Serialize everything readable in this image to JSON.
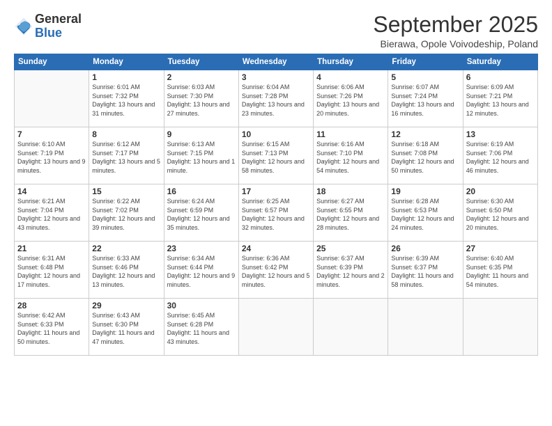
{
  "logo": {
    "general": "General",
    "blue": "Blue"
  },
  "title": "September 2025",
  "subtitle": "Bierawa, Opole Voivodeship, Poland",
  "headers": [
    "Sunday",
    "Monday",
    "Tuesday",
    "Wednesday",
    "Thursday",
    "Friday",
    "Saturday"
  ],
  "weeks": [
    [
      {
        "day": "",
        "sunrise": "",
        "sunset": "",
        "daylight": ""
      },
      {
        "day": "1",
        "sunrise": "Sunrise: 6:01 AM",
        "sunset": "Sunset: 7:32 PM",
        "daylight": "Daylight: 13 hours and 31 minutes."
      },
      {
        "day": "2",
        "sunrise": "Sunrise: 6:03 AM",
        "sunset": "Sunset: 7:30 PM",
        "daylight": "Daylight: 13 hours and 27 minutes."
      },
      {
        "day": "3",
        "sunrise": "Sunrise: 6:04 AM",
        "sunset": "Sunset: 7:28 PM",
        "daylight": "Daylight: 13 hours and 23 minutes."
      },
      {
        "day": "4",
        "sunrise": "Sunrise: 6:06 AM",
        "sunset": "Sunset: 7:26 PM",
        "daylight": "Daylight: 13 hours and 20 minutes."
      },
      {
        "day": "5",
        "sunrise": "Sunrise: 6:07 AM",
        "sunset": "Sunset: 7:24 PM",
        "daylight": "Daylight: 13 hours and 16 minutes."
      },
      {
        "day": "6",
        "sunrise": "Sunrise: 6:09 AM",
        "sunset": "Sunset: 7:21 PM",
        "daylight": "Daylight: 13 hours and 12 minutes."
      }
    ],
    [
      {
        "day": "7",
        "sunrise": "Sunrise: 6:10 AM",
        "sunset": "Sunset: 7:19 PM",
        "daylight": "Daylight: 13 hours and 9 minutes."
      },
      {
        "day": "8",
        "sunrise": "Sunrise: 6:12 AM",
        "sunset": "Sunset: 7:17 PM",
        "daylight": "Daylight: 13 hours and 5 minutes."
      },
      {
        "day": "9",
        "sunrise": "Sunrise: 6:13 AM",
        "sunset": "Sunset: 7:15 PM",
        "daylight": "Daylight: 13 hours and 1 minute."
      },
      {
        "day": "10",
        "sunrise": "Sunrise: 6:15 AM",
        "sunset": "Sunset: 7:13 PM",
        "daylight": "Daylight: 12 hours and 58 minutes."
      },
      {
        "day": "11",
        "sunrise": "Sunrise: 6:16 AM",
        "sunset": "Sunset: 7:10 PM",
        "daylight": "Daylight: 12 hours and 54 minutes."
      },
      {
        "day": "12",
        "sunrise": "Sunrise: 6:18 AM",
        "sunset": "Sunset: 7:08 PM",
        "daylight": "Daylight: 12 hours and 50 minutes."
      },
      {
        "day": "13",
        "sunrise": "Sunrise: 6:19 AM",
        "sunset": "Sunset: 7:06 PM",
        "daylight": "Daylight: 12 hours and 46 minutes."
      }
    ],
    [
      {
        "day": "14",
        "sunrise": "Sunrise: 6:21 AM",
        "sunset": "Sunset: 7:04 PM",
        "daylight": "Daylight: 12 hours and 43 minutes."
      },
      {
        "day": "15",
        "sunrise": "Sunrise: 6:22 AM",
        "sunset": "Sunset: 7:02 PM",
        "daylight": "Daylight: 12 hours and 39 minutes."
      },
      {
        "day": "16",
        "sunrise": "Sunrise: 6:24 AM",
        "sunset": "Sunset: 6:59 PM",
        "daylight": "Daylight: 12 hours and 35 minutes."
      },
      {
        "day": "17",
        "sunrise": "Sunrise: 6:25 AM",
        "sunset": "Sunset: 6:57 PM",
        "daylight": "Daylight: 12 hours and 32 minutes."
      },
      {
        "day": "18",
        "sunrise": "Sunrise: 6:27 AM",
        "sunset": "Sunset: 6:55 PM",
        "daylight": "Daylight: 12 hours and 28 minutes."
      },
      {
        "day": "19",
        "sunrise": "Sunrise: 6:28 AM",
        "sunset": "Sunset: 6:53 PM",
        "daylight": "Daylight: 12 hours and 24 minutes."
      },
      {
        "day": "20",
        "sunrise": "Sunrise: 6:30 AM",
        "sunset": "Sunset: 6:50 PM",
        "daylight": "Daylight: 12 hours and 20 minutes."
      }
    ],
    [
      {
        "day": "21",
        "sunrise": "Sunrise: 6:31 AM",
        "sunset": "Sunset: 6:48 PM",
        "daylight": "Daylight: 12 hours and 17 minutes."
      },
      {
        "day": "22",
        "sunrise": "Sunrise: 6:33 AM",
        "sunset": "Sunset: 6:46 PM",
        "daylight": "Daylight: 12 hours and 13 minutes."
      },
      {
        "day": "23",
        "sunrise": "Sunrise: 6:34 AM",
        "sunset": "Sunset: 6:44 PM",
        "daylight": "Daylight: 12 hours and 9 minutes."
      },
      {
        "day": "24",
        "sunrise": "Sunrise: 6:36 AM",
        "sunset": "Sunset: 6:42 PM",
        "daylight": "Daylight: 12 hours and 5 minutes."
      },
      {
        "day": "25",
        "sunrise": "Sunrise: 6:37 AM",
        "sunset": "Sunset: 6:39 PM",
        "daylight": "Daylight: 12 hours and 2 minutes."
      },
      {
        "day": "26",
        "sunrise": "Sunrise: 6:39 AM",
        "sunset": "Sunset: 6:37 PM",
        "daylight": "Daylight: 11 hours and 58 minutes."
      },
      {
        "day": "27",
        "sunrise": "Sunrise: 6:40 AM",
        "sunset": "Sunset: 6:35 PM",
        "daylight": "Daylight: 11 hours and 54 minutes."
      }
    ],
    [
      {
        "day": "28",
        "sunrise": "Sunrise: 6:42 AM",
        "sunset": "Sunset: 6:33 PM",
        "daylight": "Daylight: 11 hours and 50 minutes."
      },
      {
        "day": "29",
        "sunrise": "Sunrise: 6:43 AM",
        "sunset": "Sunset: 6:30 PM",
        "daylight": "Daylight: 11 hours and 47 minutes."
      },
      {
        "day": "30",
        "sunrise": "Sunrise: 6:45 AM",
        "sunset": "Sunset: 6:28 PM",
        "daylight": "Daylight: 11 hours and 43 minutes."
      },
      {
        "day": "",
        "sunrise": "",
        "sunset": "",
        "daylight": ""
      },
      {
        "day": "",
        "sunrise": "",
        "sunset": "",
        "daylight": ""
      },
      {
        "day": "",
        "sunrise": "",
        "sunset": "",
        "daylight": ""
      },
      {
        "day": "",
        "sunrise": "",
        "sunset": "",
        "daylight": ""
      }
    ]
  ]
}
